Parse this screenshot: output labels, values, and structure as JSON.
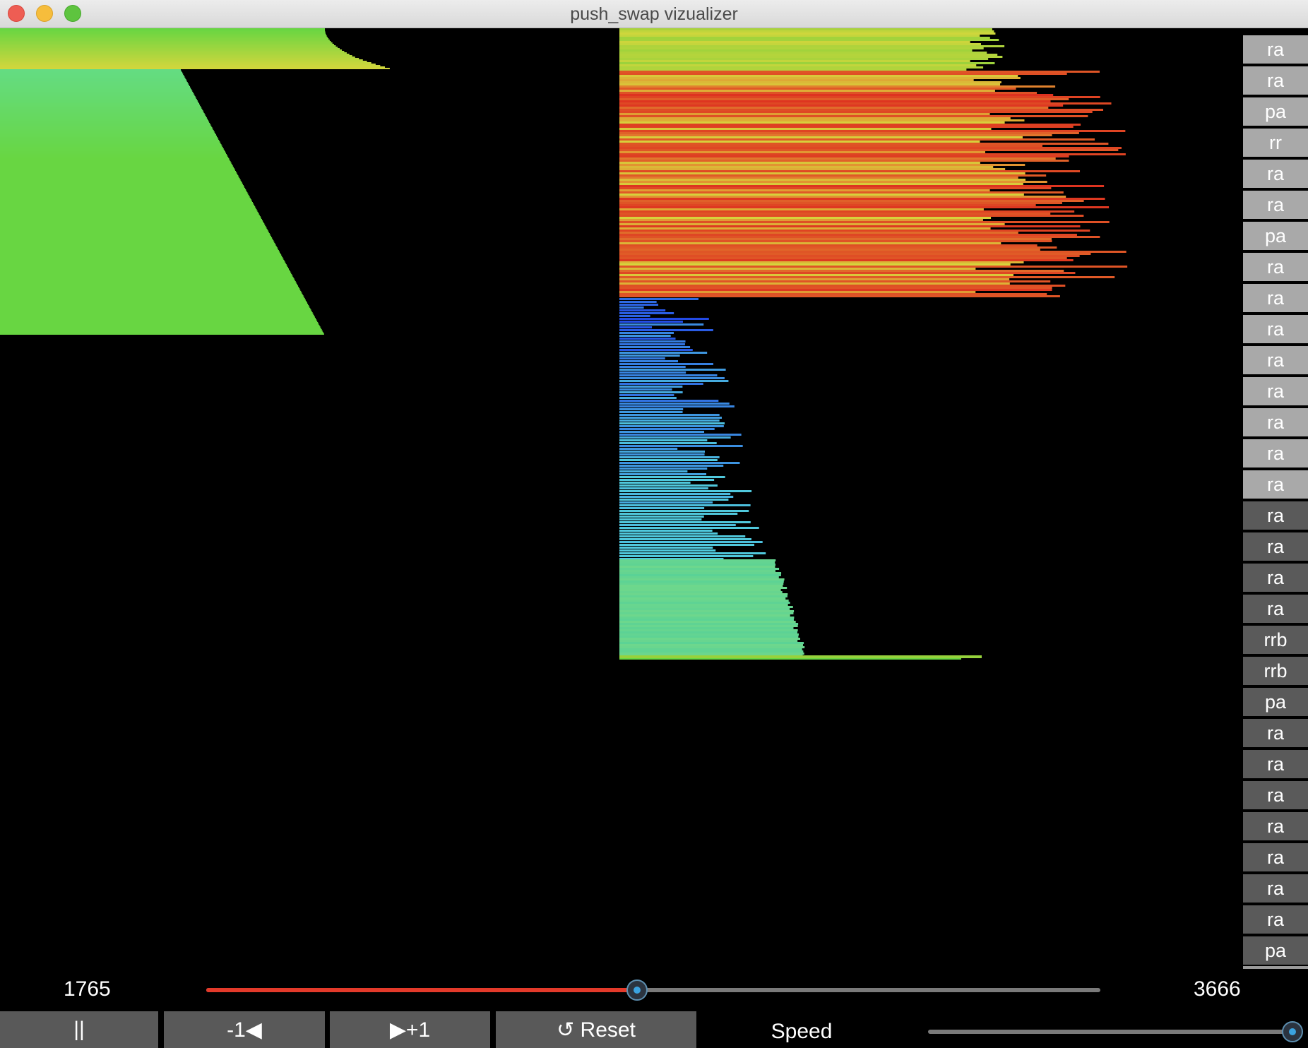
{
  "window": {
    "title": "push_swap vizualizer"
  },
  "operations": {
    "items": [
      "ra",
      "ra",
      "pa",
      "rr",
      "ra",
      "ra",
      "pa",
      "ra",
      "ra",
      "ra",
      "ra",
      "ra",
      "ra",
      "ra",
      "ra",
      "ra",
      "ra",
      "ra",
      "ra",
      "rrb",
      "rrb",
      "pa",
      "ra",
      "ra",
      "ra",
      "ra",
      "ra",
      "ra",
      "ra",
      "pa"
    ],
    "current_index": 15,
    "done_color": "#a9a9a9",
    "next_color": "#5a5a5a"
  },
  "scrubber": {
    "current_step": "1765",
    "total_steps": "3666",
    "progress": 0.4815
  },
  "controls": {
    "pause_label": "||",
    "step_back_label": "-1◀",
    "step_forward_label": "▶+1",
    "reset_label": "↺ Reset",
    "speed_label": "Speed",
    "speed_value": 1.0
  },
  "colors": {
    "accent": "#e33a2a",
    "slider_thumb": "#3ba3e0",
    "button_bg": "#595959"
  }
}
